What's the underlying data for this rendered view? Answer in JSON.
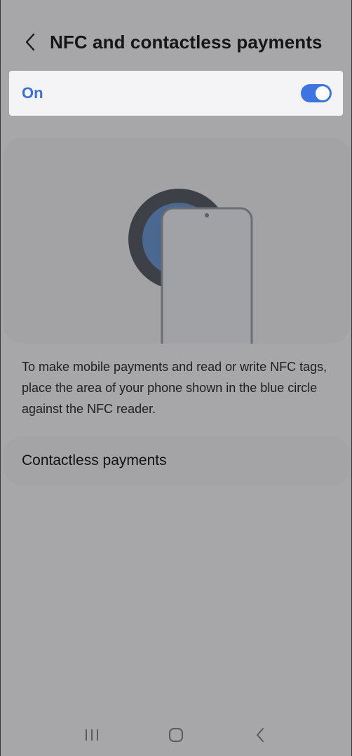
{
  "header": {
    "title": "NFC and contactless payments",
    "back_icon": "chevron-left-icon"
  },
  "toggle": {
    "label": "On",
    "state": "on",
    "accent_color": "#3e74e0"
  },
  "illustration": {
    "icon": "phone-on-nfc-reader-icon"
  },
  "description": "To make mobile payments and read or write NFC tags, place the area of your phone shown in the blue circle against the NFC reader.",
  "menu": {
    "items": [
      {
        "label": "Contactless payments"
      }
    ]
  },
  "navbar": {
    "recent_icon": "recent-apps-icon",
    "home_icon": "home-icon",
    "back_icon": "back-icon"
  }
}
